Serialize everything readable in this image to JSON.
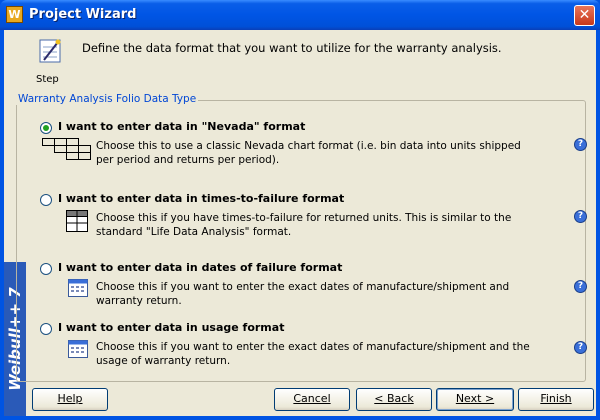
{
  "window": {
    "title": "Project Wizard",
    "app_icon_letter": "W"
  },
  "header": {
    "step_label": "Step",
    "text": "Define the data format that you want to utilize for the warranty analysis."
  },
  "sidebar": {
    "brand": "Weibull++ 7"
  },
  "group": {
    "legend": "Warranty Analysis Folio Data Type"
  },
  "options": [
    {
      "label": "I want to enter data in \"Nevada\" format",
      "desc": "Choose this to use a classic Nevada chart format (i.e. bin data into units shipped per period and returns per period).",
      "selected": true,
      "icon": "nevada-grid-icon"
    },
    {
      "label": "I want to enter data in times-to-failure format",
      "desc": "Choose this if you have times-to-failure for returned units. This is similar to the standard \"Life Data Analysis\" format.",
      "selected": false,
      "icon": "table-grid-icon"
    },
    {
      "label": "I want to enter data in dates of failure format",
      "desc": "Choose this if you want to enter the exact dates of manufacture/shipment and warranty return.",
      "selected": false,
      "icon": "calendar-icon"
    },
    {
      "label": "I want to enter data in usage format",
      "desc": "Choose this if you want to enter the exact dates of manufacture/shipment and the usage of warranty return.",
      "selected": false,
      "icon": "calendar-icon"
    }
  ],
  "buttons": {
    "help": "Help",
    "cancel": "Cancel",
    "back": "< Back",
    "next": "Next >",
    "finish": "Finish"
  },
  "colors": {
    "title_bar": "#0055e5",
    "dialog_bg": "#ece9d8",
    "legend_text": "#0046d5",
    "sidebar": "#2a5ab8",
    "radio_dot": "#21a121"
  }
}
